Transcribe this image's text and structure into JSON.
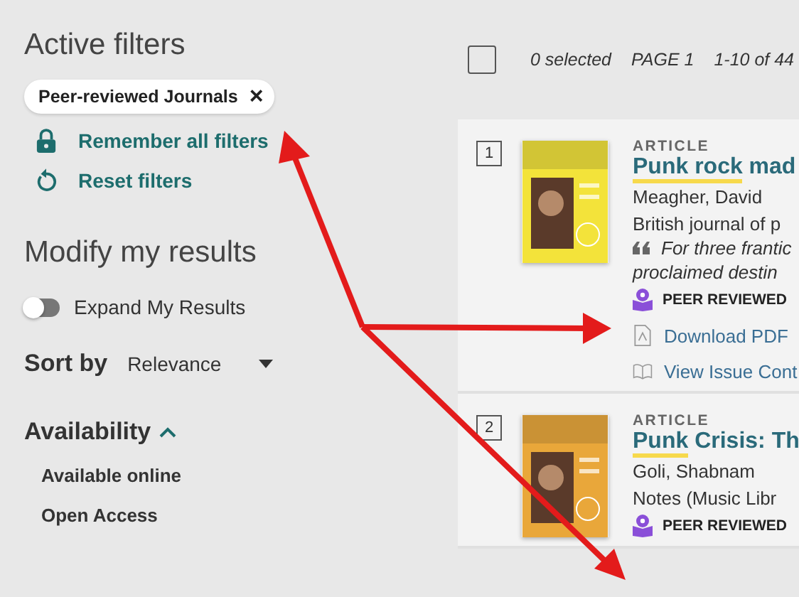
{
  "active_filters": {
    "heading": "Active filters",
    "chips": [
      {
        "label": "Peer-reviewed Journals",
        "close": "×"
      }
    ],
    "remember": "Remember all filters",
    "reset": "Reset filters"
  },
  "modify": {
    "heading": "Modify my results",
    "expand": {
      "label": "Expand My Results",
      "on": false
    },
    "sort_label": "Sort by",
    "sort_value": "Relevance"
  },
  "availability": {
    "heading": "Availability",
    "expanded": true,
    "items": [
      "Available online",
      "Open Access"
    ]
  },
  "toolbar": {
    "checked": false,
    "selected_count": "0 selected",
    "page": "PAGE 1",
    "range": "1-10 of 44"
  },
  "results": [
    {
      "number": "1",
      "type": "ARTICLE",
      "title_highlight": "Punk rock",
      "title_rest": " mad",
      "author": "Meagher, David",
      "source": "British journal of p",
      "quote_lines": [
        "For three frantic",
        "proclaimed destin"
      ],
      "peer_reviewed": "PEER REVIEWED",
      "links": [
        {
          "kind": "pdf",
          "label": "Download PDF"
        },
        {
          "kind": "book",
          "label": "View Issue Cont"
        }
      ]
    },
    {
      "number": "2",
      "type": "ARTICLE",
      "title_highlight": "Punk",
      "title_rest": " Crisis: Th",
      "author": "Goli, Shabnam",
      "source": "Notes (Music Libr",
      "peer_reviewed": "PEER REVIEWED"
    }
  ]
}
